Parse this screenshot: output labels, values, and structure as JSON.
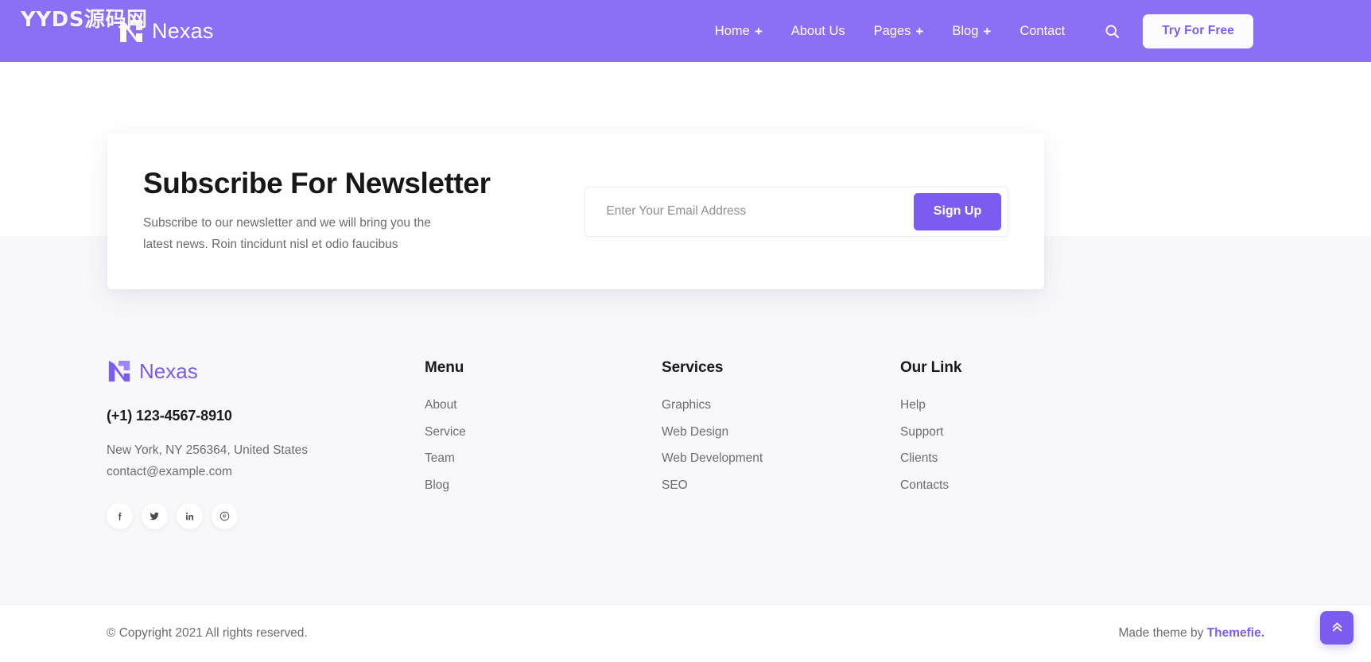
{
  "watermark": "YYDS源码网",
  "brand": {
    "name": "Nexas",
    "logo_icon": "nexas-arrow-logo"
  },
  "header": {
    "nav": [
      {
        "label": "Home",
        "has_dropdown": true,
        "plus": "+"
      },
      {
        "label": "About Us",
        "has_dropdown": false,
        "plus": ""
      },
      {
        "label": "Pages",
        "has_dropdown": true,
        "plus": "+"
      },
      {
        "label": "Blog",
        "has_dropdown": true,
        "plus": "+"
      },
      {
        "label": "Contact",
        "has_dropdown": false,
        "plus": ""
      }
    ],
    "search_icon": "search-icon",
    "cta_label": "Try For Free",
    "bg_color": "#8b6ff5",
    "cta_text_color": "#7c5cf0"
  },
  "newsletter": {
    "title": "Subscribe For Newsletter",
    "description": "Subscribe to our newsletter and we will bring you the latest news. Roin tincidunt nisl et odio faucibus",
    "input_placeholder": "Enter Your Email Address",
    "input_value": "",
    "button_label": "Sign Up",
    "button_color": "#7c5cf0"
  },
  "footer": {
    "brand_name": "Nexas",
    "phone": "(+1) 123-4567-8910",
    "address": "New York, NY 256364, United States",
    "email": "contact@example.com",
    "socials": [
      {
        "name": "facebook-icon",
        "label": "f"
      },
      {
        "name": "twitter-icon",
        "label": "t"
      },
      {
        "name": "linkedin-icon",
        "label": "in"
      },
      {
        "name": "pinterest-icon",
        "label": "p"
      }
    ],
    "columns": [
      {
        "title": "Menu",
        "items": [
          "About",
          "Service",
          "Team",
          "Blog"
        ]
      },
      {
        "title": "Services",
        "items": [
          "Graphics",
          "Web Design",
          "Web Development",
          "SEO"
        ]
      },
      {
        "title": "Our Link",
        "items": [
          "Help",
          "Support",
          "Clients",
          "Contacts"
        ]
      }
    ]
  },
  "bottom": {
    "copyright": "© Copyright 2021 All rights reserved.",
    "made_prefix": "Made theme by ",
    "made_brand": "Themefie.",
    "scroll_top_icon": "double-chevron-up-icon"
  }
}
